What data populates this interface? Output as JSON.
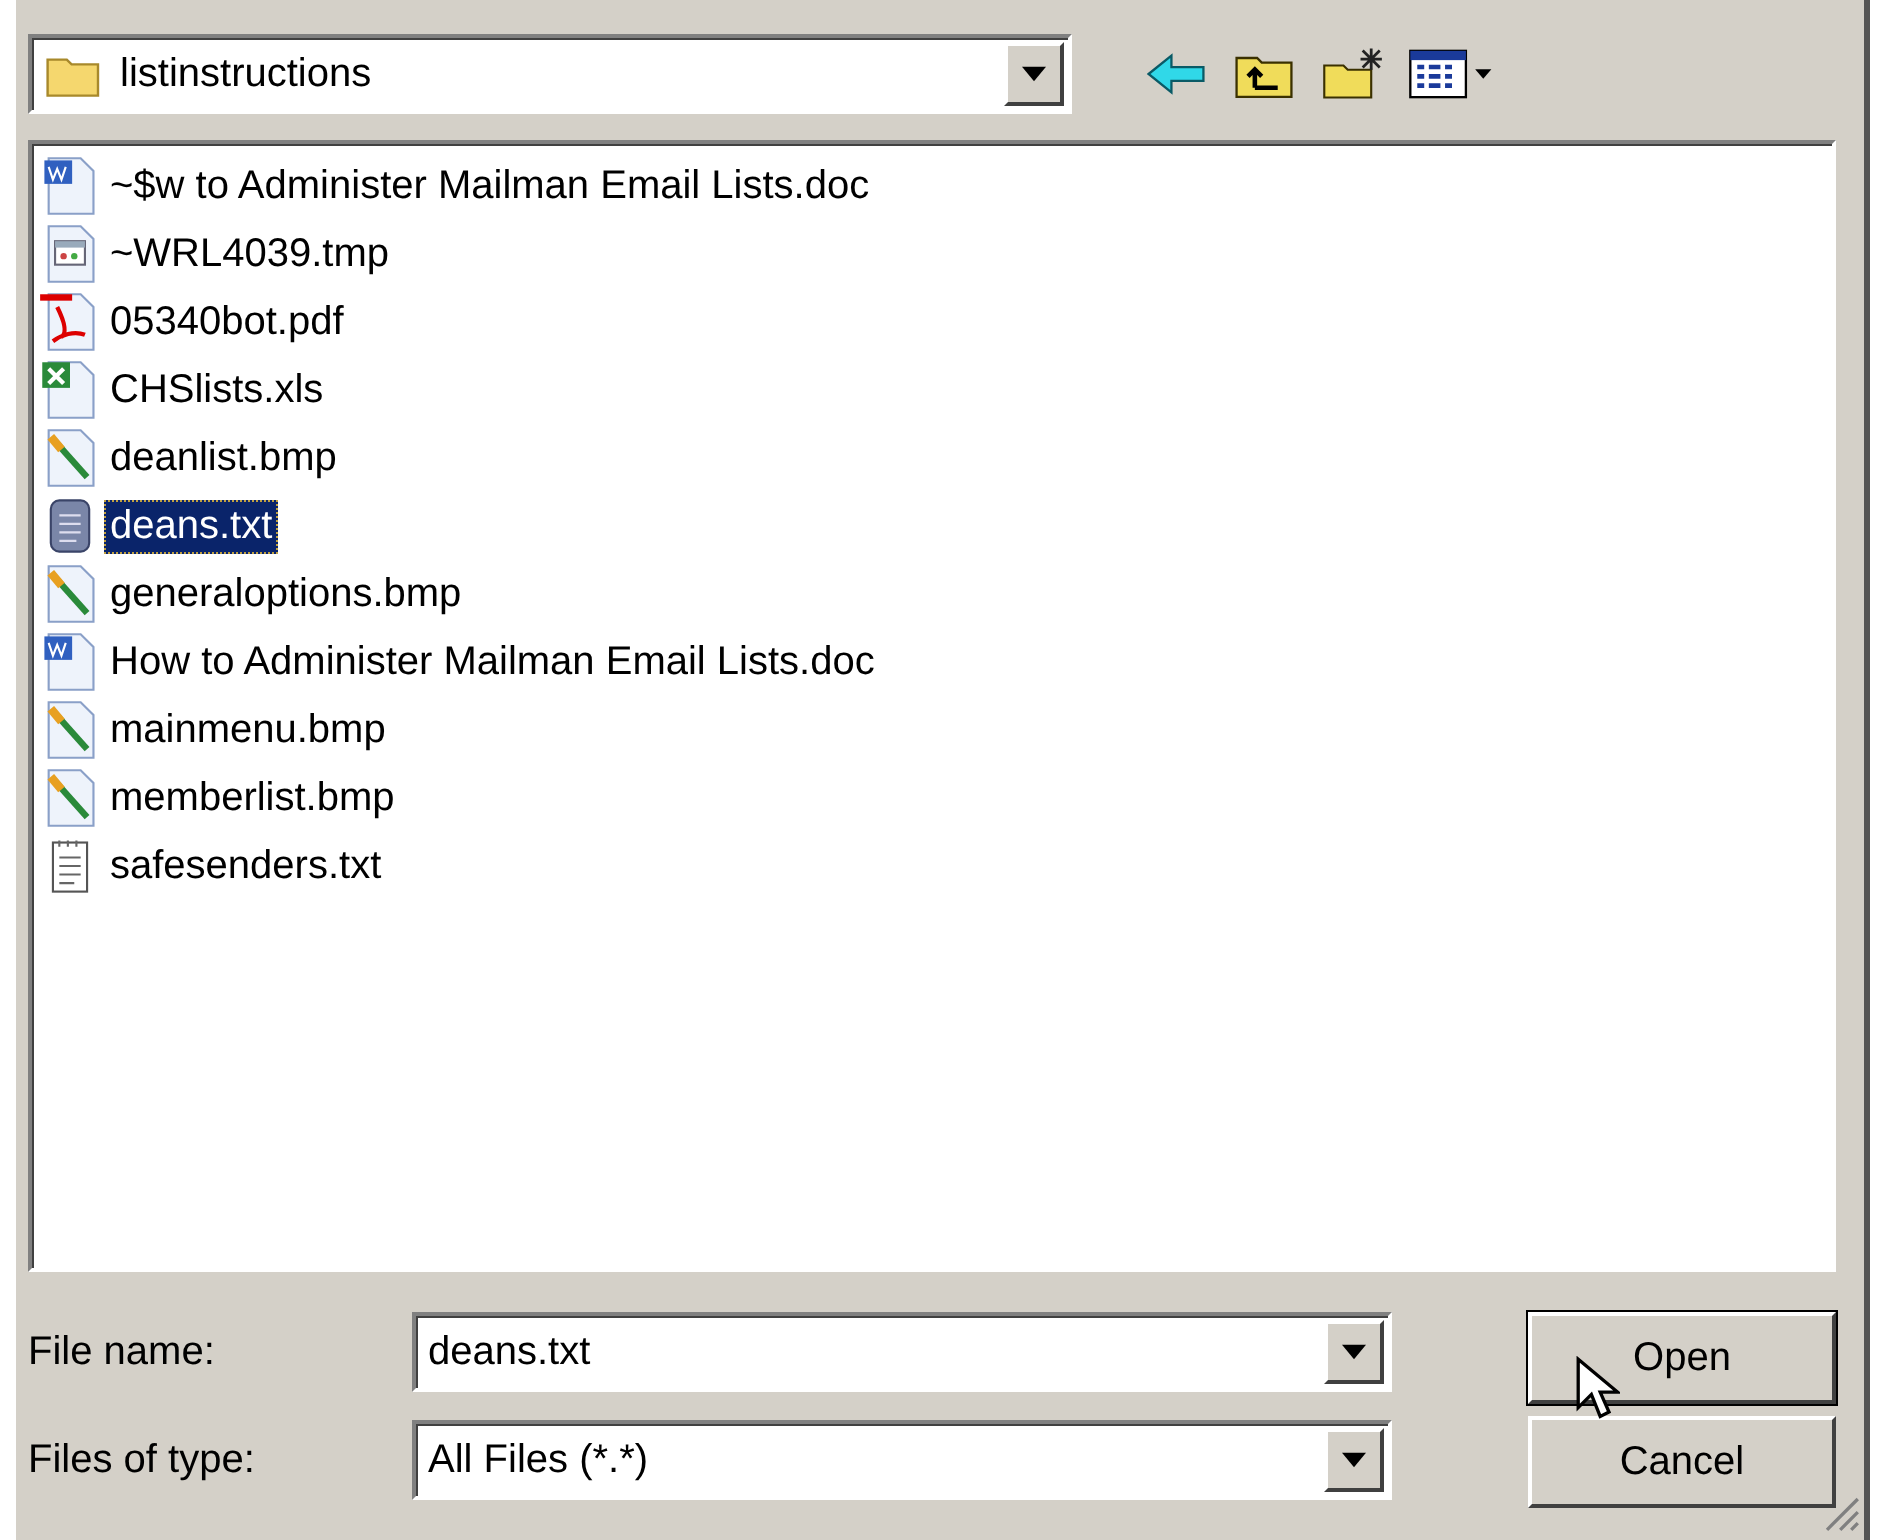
{
  "look_in": {
    "value": "listinstructions"
  },
  "files": [
    {
      "name": "~$w to Administer Mailman Email Lists.doc",
      "kind": "doc",
      "selected": false
    },
    {
      "name": "~WRL4039.tmp",
      "kind": "tmp",
      "selected": false
    },
    {
      "name": "05340bot.pdf",
      "kind": "pdf",
      "selected": false
    },
    {
      "name": "CHSlists.xls",
      "kind": "xls",
      "selected": false
    },
    {
      "name": "deanlist.bmp",
      "kind": "bmp",
      "selected": false
    },
    {
      "name": "deans.txt",
      "kind": "txt",
      "selected": true
    },
    {
      "name": "generaloptions.bmp",
      "kind": "bmp",
      "selected": false
    },
    {
      "name": "How to Administer Mailman Email Lists.doc",
      "kind": "doc",
      "selected": false
    },
    {
      "name": "mainmenu.bmp",
      "kind": "bmp",
      "selected": false
    },
    {
      "name": "memberlist.bmp",
      "kind": "bmp",
      "selected": false
    },
    {
      "name": "safesenders.txt",
      "kind": "note",
      "selected": false
    }
  ],
  "file_name": {
    "label": "File name:",
    "value": "deans.txt"
  },
  "file_type": {
    "label": "Files of type:",
    "value": "All Files (*.*)"
  },
  "buttons": [
    "Open",
    "Cancel"
  ]
}
